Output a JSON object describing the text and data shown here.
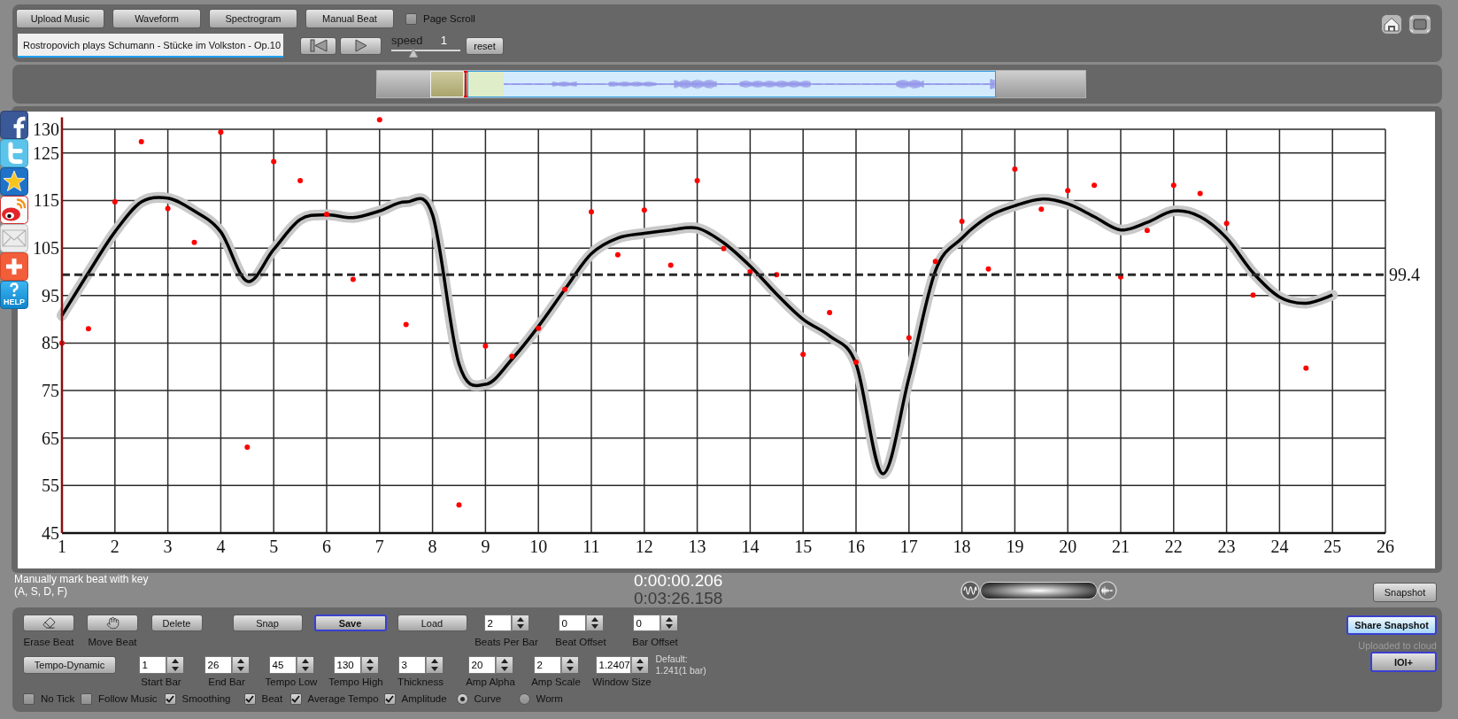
{
  "toolbar": {
    "buttons": [
      {
        "label": "Upload Music"
      },
      {
        "label": "Waveform"
      },
      {
        "label": "Spectrogram"
      },
      {
        "label": "Manual Beat"
      }
    ],
    "page_scroll": {
      "label": "Page Scroll",
      "checked": false
    }
  },
  "player": {
    "track": {
      "value": "Rostropovich plays Schumann - Stücke im Volkston - Op.10"
    },
    "speed": {
      "label": "speed",
      "value": "1",
      "level": 0.32
    },
    "reset": {
      "label": "reset"
    }
  },
  "social": {
    "help_label": "HELP"
  },
  "chart": {
    "chart_data": {
      "type": "line",
      "grid": true,
      "xlim": [
        1,
        26
      ],
      "ylim": [
        45,
        132.5
      ],
      "xticks": [
        1,
        2,
        3,
        4,
        5,
        6,
        7,
        8,
        9,
        10,
        11,
        12,
        13,
        14,
        15,
        16,
        17,
        18,
        19,
        20,
        21,
        22,
        23,
        24,
        25,
        26
      ],
      "yticks": [
        45,
        55,
        65,
        75,
        85,
        95,
        105,
        115,
        125,
        130
      ],
      "x": [
        1,
        1.5,
        2,
        2.5,
        3,
        3.5,
        4,
        4.5,
        5,
        5.5,
        6,
        6.5,
        7,
        7.5,
        8,
        8.5,
        9,
        9.5,
        10,
        10.5,
        11,
        11.5,
        12,
        12.5,
        13,
        13.5,
        14,
        14.5,
        15,
        15.5,
        16,
        16.5,
        17,
        17.5,
        18,
        18.5,
        19,
        19.5,
        20,
        20.5,
        21,
        21.5,
        22,
        22.5,
        23,
        23.5,
        24,
        24.5,
        25
      ],
      "series": [
        {
          "color": "#000000",
          "values": [
            90.8,
            99.8,
            108.4,
            114.7,
            115.5,
            112.8,
            108.4,
            98,
            104.7,
            111,
            112,
            111.4,
            112.8,
            114.7,
            112,
            80.6,
            76.3,
            81.6,
            88.5,
            96.3,
            103.8,
            107.1,
            108.1,
            108.8,
            109.2,
            106.1,
            101.2,
            95.3,
            90,
            86.5,
            80.6,
            57.5,
            77.7,
            100.2,
            107.1,
            111.6,
            113.9,
            115.3,
            114.3,
            111.6,
            108.8,
            110.4,
            112.8,
            111.6,
            107.1,
            99.8,
            94.7,
            93.4,
            95.1
          ]
        },
        {
          "type": "scatter",
          "color": "#ff0000",
          "values": [
            85,
            88,
            114.7,
            127.4,
            113.3,
            106.2,
            129.4,
            63.1,
            123.2,
            119.2,
            112.1,
            98.4,
            132,
            88.9,
            null,
            50.9,
            84.4,
            82.2,
            88.1,
            96.3,
            112.6,
            103.6,
            113,
            101.4,
            119.2,
            104.9,
            100,
            99.4,
            82.6,
            91.4,
            81,
            null,
            86.1,
            102.2,
            110.6,
            100.6,
            121.6,
            113.2,
            117.1,
            118.2,
            98.9,
            108.7,
            118.2,
            116.5,
            110.2,
            95.1,
            null,
            79.7,
            null
          ]
        }
      ],
      "ref_lines": [
        {
          "axis": "y",
          "value": 99.4,
          "label": "99.4"
        }
      ]
    }
  },
  "hint_lines": [
    "Manually mark beat with key",
    "(A, S, D, F)"
  ],
  "time": {
    "position": "0:00:00.206",
    "duration": "0:03:26.158"
  },
  "snapshot": {
    "label": "Snapshot"
  },
  "controls": {
    "buttons": [
      {
        "kind": "icon",
        "label": "Erase Beat",
        "outlined": false
      },
      {
        "kind": "icon",
        "label": "Move Beat",
        "outlined": false
      },
      {
        "kind": "text",
        "label": "Delete",
        "outlined": false
      },
      {
        "kind": "text",
        "label": "Snap",
        "outlined": false
      },
      {
        "kind": "text",
        "label": "Save",
        "outlined": true
      },
      {
        "kind": "text",
        "label": "Load",
        "outlined": false
      }
    ],
    "offsets": [
      {
        "label": "Beats Per Bar",
        "value": "2"
      },
      {
        "label": "Beat Offset",
        "value": "0"
      },
      {
        "label": "Bar Offset",
        "value": "0"
      }
    ],
    "mode": {
      "label": "Tempo-Dynamic"
    },
    "settings": [
      {
        "label": "Start Bar",
        "value": "1"
      },
      {
        "label": "End Bar",
        "value": "26"
      },
      {
        "label": "Tempo Low",
        "value": "45"
      },
      {
        "label": "Tempo High",
        "value": "130"
      },
      {
        "label": "Thickness",
        "value": "3"
      },
      {
        "label": "Amp Alpha",
        "value": "20"
      },
      {
        "label": "Amp Scale",
        "value": "2"
      },
      {
        "label": "Window Size",
        "value": "1.2407"
      }
    ],
    "default_note": [
      "Default:",
      "1.241(1 bar)"
    ],
    "checkboxes": [
      {
        "label": "No Tick",
        "checked": false
      },
      {
        "label": "Follow Music",
        "checked": false
      },
      {
        "label": "Smoothing",
        "checked": true
      },
      {
        "label": "Beat",
        "checked": true
      },
      {
        "label": "Average Tempo",
        "checked": true
      },
      {
        "label": "Amplitude",
        "checked": true
      }
    ],
    "radios": [
      {
        "label": "Curve",
        "selected": true
      },
      {
        "label": "Worm",
        "selected": false
      }
    ]
  },
  "share_button": {
    "label": "Share Snapshot",
    "highlighted": true,
    "outlined": true
  },
  "upload_status": "Uploaded to cloud",
  "ioi_button": {
    "label": "IOI+",
    "highlighted": false,
    "outlined": true
  }
}
